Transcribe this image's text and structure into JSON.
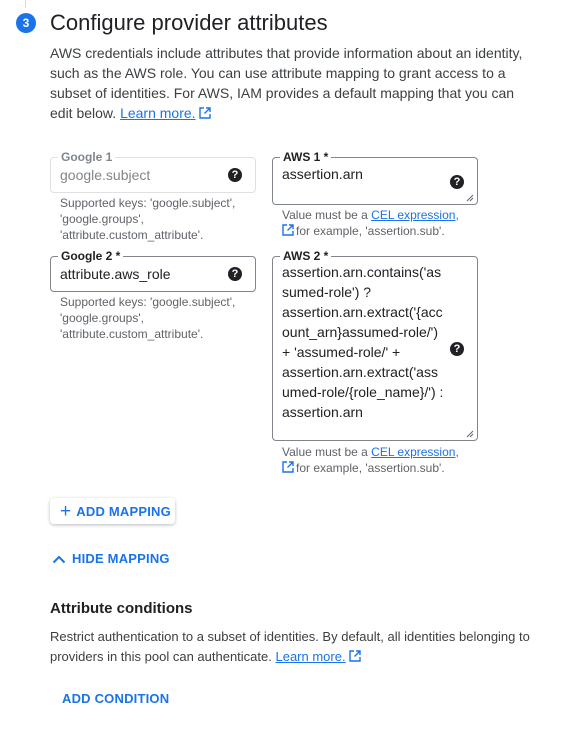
{
  "step": {
    "number": "3",
    "title": "Configure provider attributes",
    "intro": "AWS credentials include attributes that provide information about an identity, such as the AWS role. You can use attribute mapping to grant access to a subset of identities. For AWS, IAM provides a default mapping that you can edit below.",
    "learn_more": "Learn more."
  },
  "mappings": [
    {
      "google": {
        "label": "Google 1",
        "value": "google.subject",
        "hint": "Supported keys: 'google.subject', 'google.groups', 'attribute.custom_attribute'."
      },
      "aws": {
        "label": "AWS 1 *",
        "value": "assertion.arn",
        "hint_prefix": "Value must be a ",
        "hint_link": "CEL expression",
        "hint_suffix": "for example, 'assertion.sub'."
      }
    },
    {
      "google": {
        "label": "Google 2 *",
        "value": "attribute.aws_role",
        "hint": "Supported keys: 'google.subject', 'google.groups', 'attribute.custom_attribute'."
      },
      "aws": {
        "label": "AWS 2 *",
        "lines": [
          "assertion.arn.contains('as",
          "sumed-role') ?",
          "assertion.arn.extract('{acc",
          "ount_arn}assumed-role/')",
          "+ 'assumed-role/' +",
          "assertion.arn.extract('ass",
          "umed-role/{role_name}/') :",
          "assertion.arn"
        ],
        "hint_prefix": "Value must be a ",
        "hint_link": "CEL expression",
        "hint_suffix": "for example, 'assertion.sub'."
      }
    }
  ],
  "help_icon": "?",
  "add_mapping": "ADD MAPPING",
  "hide_mapping": "HIDE MAPPING",
  "conditions": {
    "title": "Attribute conditions",
    "desc": "Restrict authentication to a subset of identities. By default, all identities belonging to providers in this pool can authenticate.",
    "learn_more": "Learn more.",
    "add_condition": "ADD CONDITION"
  },
  "colors": {
    "accent": "#1a73e8",
    "text": "#202124",
    "muted": "#5f6368"
  },
  "icons": [
    "help-icon",
    "external-link-icon",
    "plus-icon",
    "chevron-up-icon",
    "resize-handle-icon"
  ]
}
